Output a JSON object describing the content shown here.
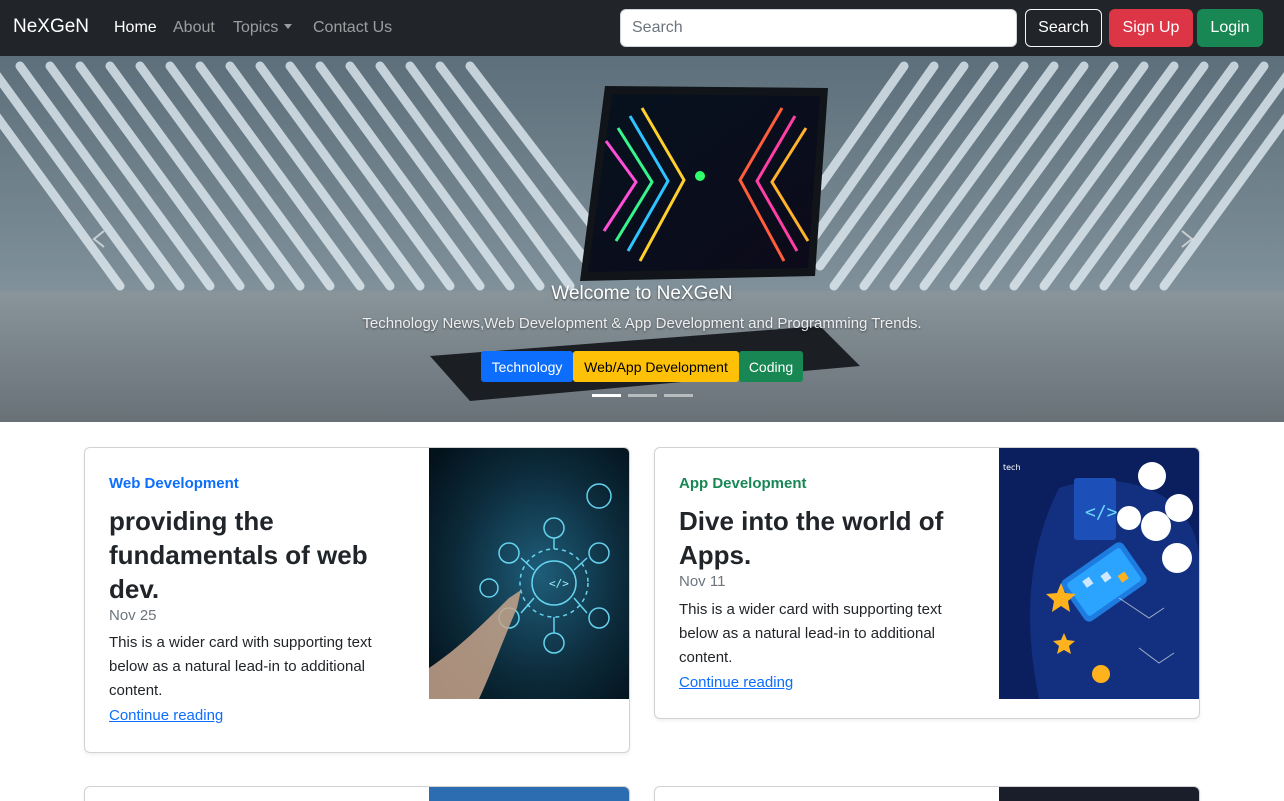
{
  "navbar": {
    "brand": "NeXGeN",
    "links": [
      "Home",
      "About",
      "Topics",
      "Contact Us"
    ],
    "search_placeholder": "Search",
    "search_button": "Search",
    "signup_button": "Sign Up",
    "login_button": "Login"
  },
  "carousel": {
    "title": "Welcome to NeXGeN",
    "subtitle": "Technology News,Web Development & App Development and Programming Trends.",
    "badges": [
      "Technology",
      "Web/App Development",
      "Coding"
    ],
    "active_slide": 1,
    "slide_count": 3
  },
  "cards": [
    {
      "category": "Web Development",
      "title": "providing the fundamentals of web dev.",
      "date": "Nov 25",
      "text": "This is a wider card with supporting text below as a natural lead-in to additional content.",
      "link": "Continue reading"
    },
    {
      "category": "App Development",
      "title": "Dive into the world of Apps.",
      "date": "Nov 11",
      "text": "This is a wider card with supporting text below as a natural lead-in to additional content.",
      "link": "Continue reading"
    }
  ],
  "colors": {
    "navbar_bg": "#212529",
    "primary": "#0d6efd",
    "success": "#198754",
    "danger": "#dc3545",
    "warning": "#ffc107"
  }
}
